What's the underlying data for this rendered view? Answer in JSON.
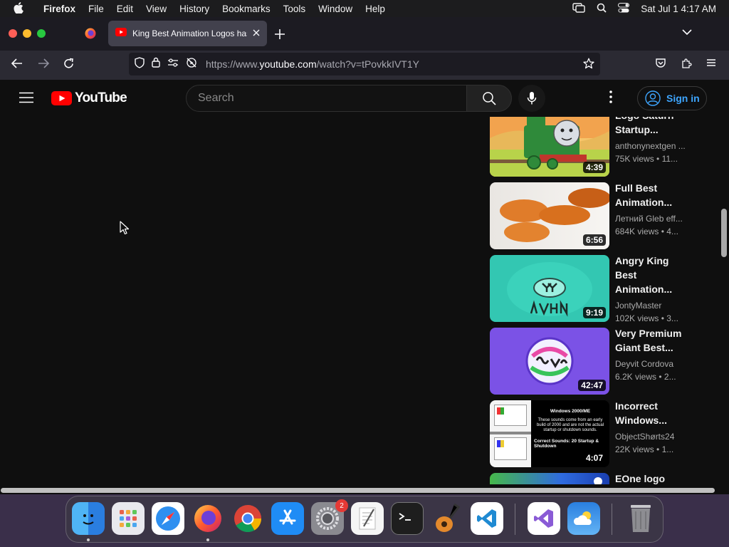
{
  "menubar": {
    "app_name": "Firefox",
    "items": [
      "File",
      "Edit",
      "View",
      "History",
      "Bookmarks",
      "Tools",
      "Window",
      "Help"
    ],
    "clock": "Sat Jul 1  4:17 AM"
  },
  "browser": {
    "active_tab_title": "King Best Animation Logos has",
    "url_prefix": "https://www.",
    "url_host": "youtube.com",
    "url_path": "/watch?v=tPovkkIVT1Y"
  },
  "youtube": {
    "logo_text": "YouTube",
    "search_placeholder": "Search",
    "signin_label": "Sign in",
    "recommendations": [
      {
        "title": "Logo Saturn Startup...",
        "channel": "anthonynextgen ...",
        "views": "75K views",
        "age": "• 11...",
        "duration": "4:39",
        "thumb": "train"
      },
      {
        "title": "Full Best Animation...",
        "channel": "Летний Gleb eff...",
        "views": "684K views",
        "age": "• 4...",
        "duration": "6:56",
        "thumb": "carrot"
      },
      {
        "title": "Angry King Best Animation...",
        "channel": "JontyMaster",
        "views": "102K views",
        "age": "• 3...",
        "duration": "9:19",
        "thumb": "teal"
      },
      {
        "title": "Very Premium Giant Best...",
        "channel": "Deyvit Cordova",
        "views": "6.2K views",
        "age": "• 2...",
        "duration": "42:47",
        "thumb": "purple"
      },
      {
        "title": "Incorrect Windows...",
        "channel": "ObjectShørts24",
        "views": "22K views",
        "age": "• 1...",
        "duration": "4:07",
        "thumb": "windows"
      },
      {
        "title": "EOne logo",
        "channel": "",
        "views": "",
        "age": "",
        "duration": "",
        "thumb": "eone"
      }
    ],
    "windows_thumb_text": {
      "heading": "Windows 2000/ME",
      "body": "These sounds come from an early build of 2000 and are not the actual startup or shutdown sounds.",
      "footer": "Correct Sounds: 20 Startup & Shutdown"
    }
  },
  "dock": {
    "settings_badge": "2",
    "apps": [
      "finder-icon",
      "launchpad-icon",
      "safari-icon",
      "firefox-icon",
      "chrome-icon",
      "app-store-icon",
      "system-settings-icon",
      "textedit-icon",
      "terminal-icon",
      "garageband-icon",
      "vscode-icon",
      "visual-studio-icon",
      "weather-icon",
      "trash-icon"
    ]
  },
  "colors": {
    "yt_red": "#ff0000",
    "signin_blue": "#3ea6ff",
    "yt_bg": "#0f0f0f"
  }
}
